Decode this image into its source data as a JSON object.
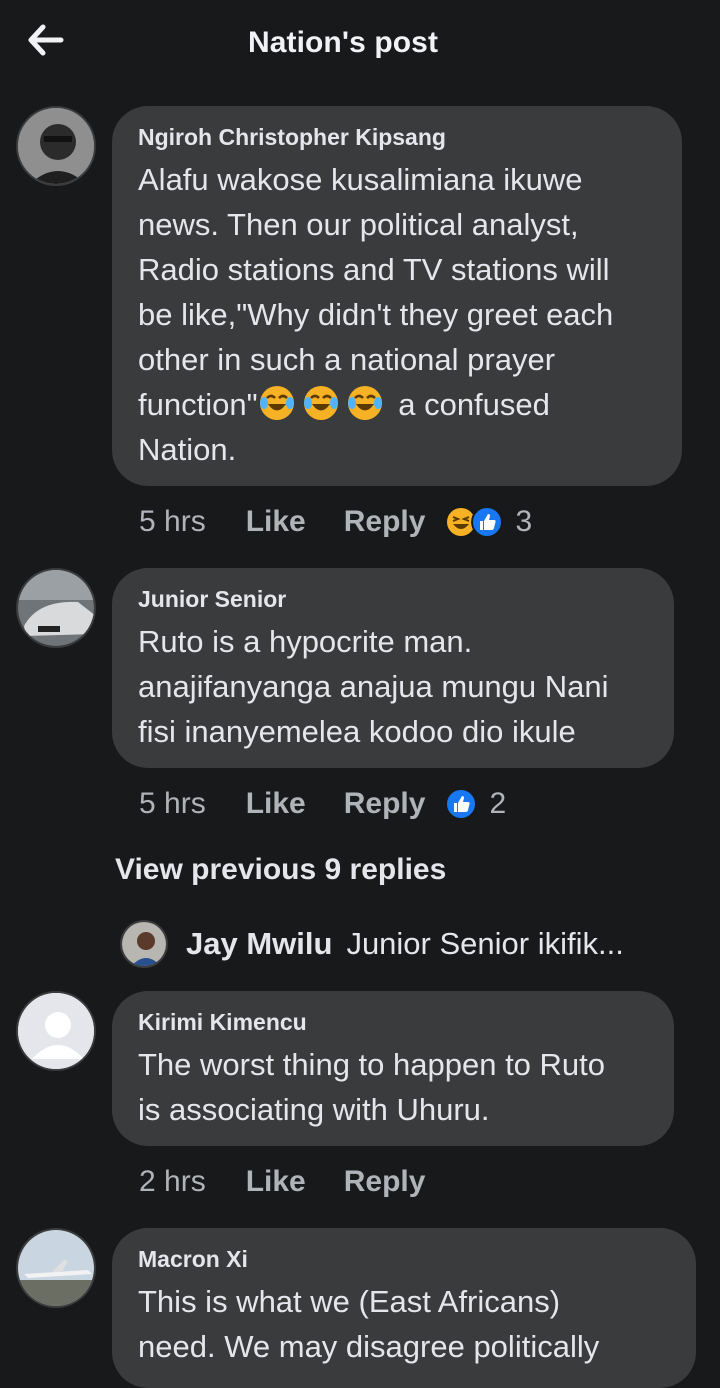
{
  "header": {
    "title": "Nation's post",
    "back_icon": "back-arrow-icon"
  },
  "comments": [
    {
      "author": "Ngiroh Christopher Kipsang",
      "text_lines": [
        "Alafu wakose kusalimiana ikuwe",
        "news. Then our political analyst,",
        "Radio stations and TV stations will",
        "be like,\"Why didn't they greet each",
        "other in such a national prayer"
      ],
      "line6_prefix": "function\"",
      "line6_suffix": "a confused",
      "line7": "Nation.",
      "time": "5 hrs",
      "like": "Like",
      "reply": "Reply",
      "reaction_count": "3"
    },
    {
      "author": "Junior Senior",
      "text_lines": [
        "Ruto is a hypocrite man.",
        "anajifanyanga anajua mungu Nani",
        "fisi inanyemelea kodoo dio ikule"
      ],
      "time": "5 hrs",
      "like": "Like",
      "reply": "Reply",
      "reaction_count": "2"
    },
    {
      "author": "Kirimi Kimencu",
      "text_lines": [
        "The worst thing to happen to Ruto",
        "is associating with Uhuru."
      ],
      "time": "2 hrs",
      "like": "Like",
      "reply": "Reply"
    },
    {
      "author": "Macron Xi",
      "text_lines": [
        "This is what we (East Africans)",
        "need. We may disagree politically"
      ]
    }
  ],
  "view_previous": "View previous 9 replies",
  "reply_preview": {
    "name": "Jay Mwilu",
    "text": "Junior Senior ikifik..."
  },
  "colors": {
    "background": "#18191a",
    "bubble": "#3a3b3c",
    "like_blue": "#1877f2",
    "haha_yellow": "#f7b125"
  }
}
